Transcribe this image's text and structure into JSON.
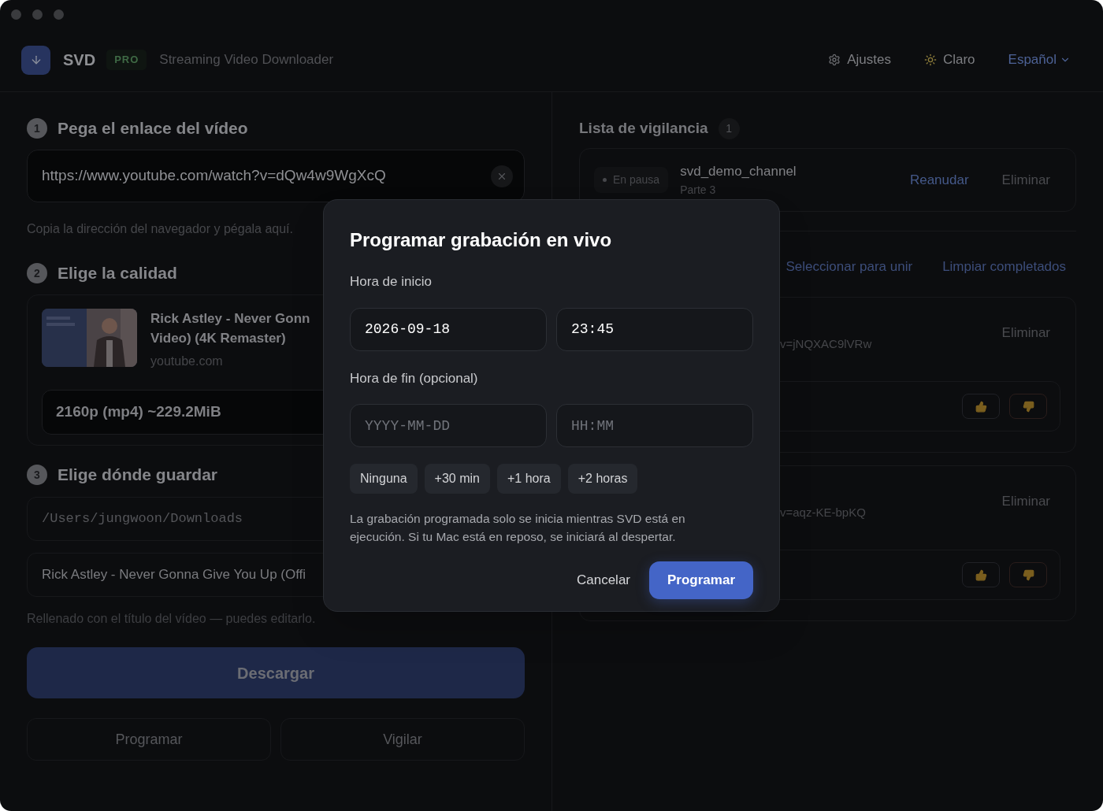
{
  "header": {
    "app_name": "SVD",
    "badge": "PRO",
    "subtitle": "Streaming Video Downloader",
    "menu": [
      {
        "label": "Ajustes",
        "kind": "settings"
      },
      {
        "label": "Claro",
        "kind": "theme"
      },
      {
        "label": "Español",
        "kind": "language"
      }
    ]
  },
  "step1": {
    "number": "1",
    "title": "Pega el enlace del vídeo",
    "url": "https://www.youtube.com/watch?v=dQw4w9WgXcQ",
    "hint": "Copia la dirección del navegador y pégala aquí."
  },
  "step2": {
    "number": "2",
    "title": "Elige la calidad",
    "video": {
      "title_lines": [
        "Rick Astley - Never Gonn",
        "Video) (4K Remaster)"
      ],
      "source": "youtube.com"
    },
    "format": "2160p (mp4) ~229.2MiB"
  },
  "step3": {
    "number": "3",
    "title": "Elige dónde guardar",
    "folder": "/Users/jungwoon/Downloads",
    "filename": "Rick Astley - Never Gonna Give You Up (Offi",
    "hint": "Rellenado con el título del vídeo — puedes editarlo."
  },
  "download_button": "Descargar",
  "secondary_buttons": [
    "Programar",
    "Vigilar"
  ],
  "watchlist": {
    "title": "Lista de vigilancia",
    "count": "1",
    "items": [
      {
        "status": "En pausa",
        "channel": "svd_demo_channel",
        "part": "Parte 3",
        "resume": "Reanudar",
        "remove": "Eliminar"
      }
    ]
  },
  "queue": {
    "actions": [
      "Seleccionar para unir",
      "Limpiar completados"
    ],
    "items": [
      {
        "url_tail": "v=jNQXAC9lVRw",
        "remove": "Eliminar"
      },
      {
        "url_tail": "v=aqz-KE-bpKQ",
        "remove": "Eliminar"
      }
    ]
  },
  "dialog": {
    "title": "Programar grabación en vivo",
    "start_label": "Hora de inicio",
    "start_date": "2026-09-18",
    "start_time": "23:45",
    "end_label": "Hora de fin (opcional)",
    "end_date_placeholder": "YYYY-MM-DD",
    "end_time_placeholder": "HH:MM",
    "presets": [
      "Ninguna",
      "+30 min",
      "+1 hora",
      "+2 horas"
    ],
    "note": "La grabación programada solo se inicia mientras SVD está en ejecución. Si tu Mac está en reposo, se iniciará al despertar.",
    "cancel": "Cancelar",
    "confirm": "Programar"
  }
}
